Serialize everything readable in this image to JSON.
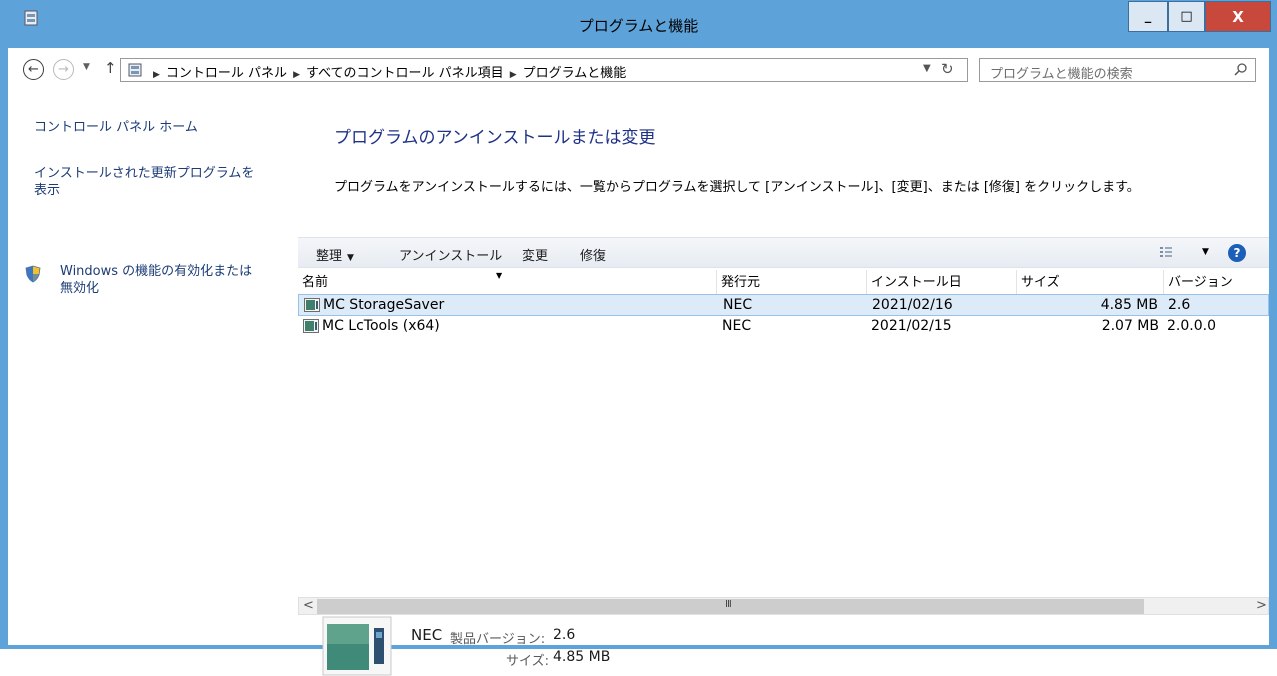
{
  "window": {
    "title": "プログラムと機能",
    "controls": {
      "minimize": "_",
      "maximize": "□",
      "close": "X"
    }
  },
  "address_bar": {
    "crumbs": [
      "コントロール パネル",
      "すべてのコントロール パネル項目",
      "プログラムと機能"
    ],
    "separator": "▶",
    "search_placeholder": "プログラムと機能の検索"
  },
  "sidebar": {
    "home": "コントロール パネル ホーム",
    "updates_line1": "インストールされた更新プログラムを",
    "updates_line2": "表示",
    "features_line1": "Windows の機能の有効化または",
    "features_line2": "無効化"
  },
  "main": {
    "heading": "プログラムのアンインストールまたは変更",
    "description": "プログラムをアンインストールするには、一覧からプログラムを選択して [アンインストール]、[変更]、または [修復] をクリックします。"
  },
  "toolbar": {
    "organize": "整理",
    "uninstall": "アンインストール",
    "change": "変更",
    "repair": "修復",
    "help": "?"
  },
  "table": {
    "columns": [
      "名前",
      "発行元",
      "インストール日",
      "サイズ",
      "バージョン"
    ],
    "rows": [
      {
        "name": "MC StorageSaver",
        "publisher": "NEC",
        "date": "2021/02/16",
        "size": "4.85 MB",
        "version": "2.6",
        "selected": true
      },
      {
        "name": "MC LcTools (x64)",
        "publisher": "NEC",
        "date": "2021/02/15",
        "size": "2.07 MB",
        "version": "2.0.0.0",
        "selected": false
      }
    ],
    "scroll_grip": "III"
  },
  "details": {
    "publisher": "NEC",
    "version_label": "製品バージョン:",
    "version_value": "2.6",
    "size_label": "サイズ:",
    "size_value": "4.85 MB"
  },
  "colors": {
    "titlebar": "#5ea2da",
    "link": "#1c3c78",
    "heading": "#1e3287",
    "selection": "#ddeaf8",
    "close_button": "#c9483c"
  }
}
